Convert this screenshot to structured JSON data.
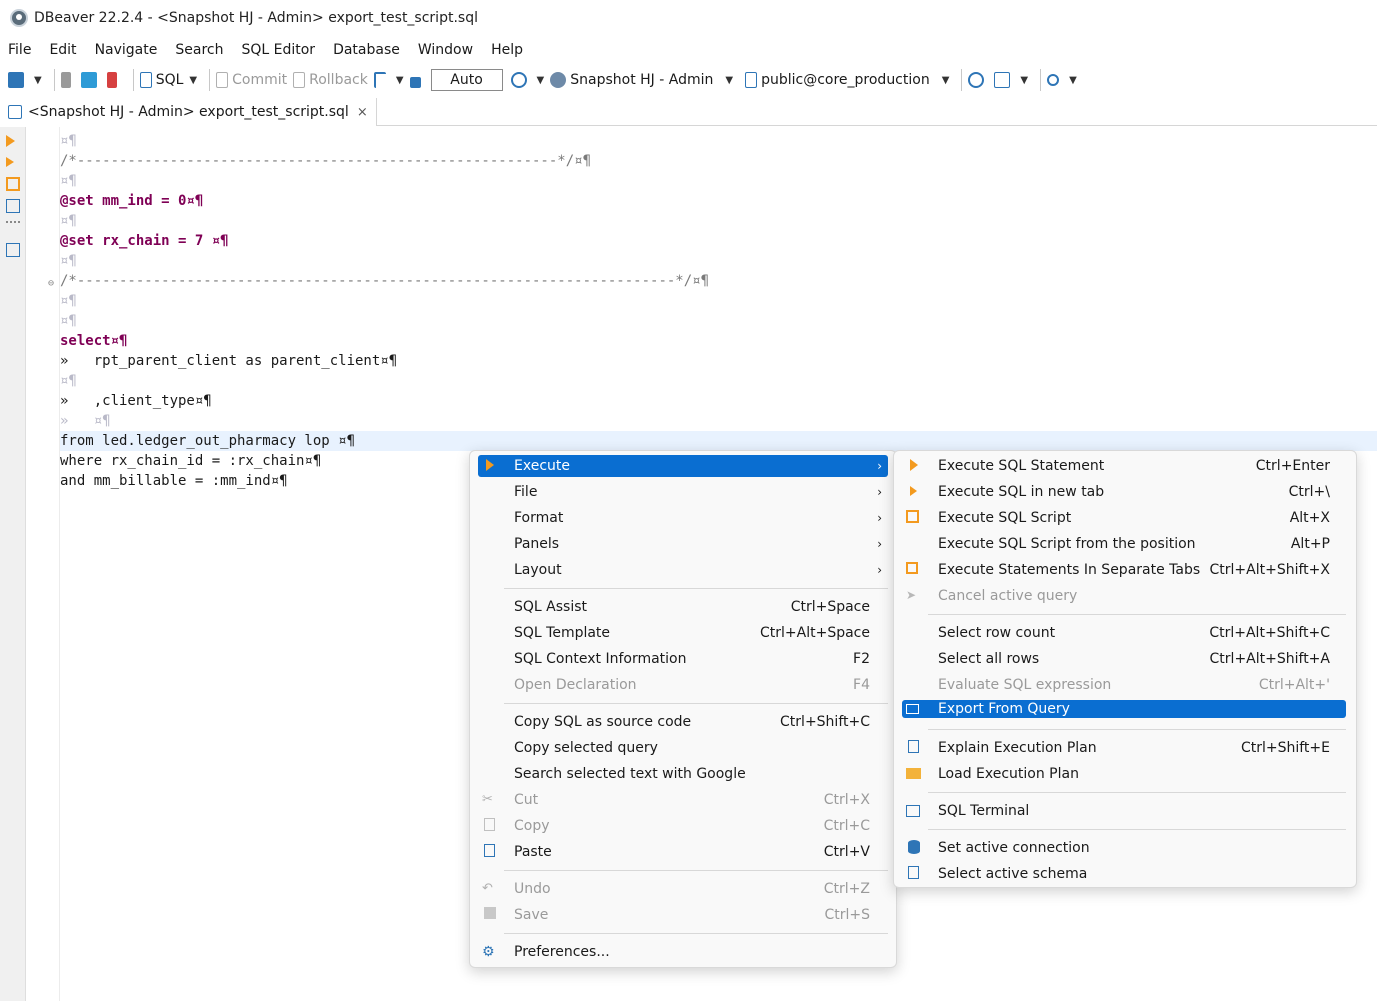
{
  "window": {
    "title": "DBeaver 22.2.4 - <Snapshot HJ - Admin> export_test_script.sql"
  },
  "menubar": [
    "File",
    "Edit",
    "Navigate",
    "Search",
    "SQL Editor",
    "Database",
    "Window",
    "Help"
  ],
  "toolbar": {
    "sql_label": "SQL",
    "commit_label": "Commit",
    "rollback_label": "Rollback",
    "auto_label": "Auto",
    "connection_label": "Snapshot HJ - Admin",
    "schema_label": "public@core_production"
  },
  "editor_tab": {
    "label": "<Snapshot HJ - Admin> export_test_script.sql",
    "close": "×"
  },
  "editor": {
    "lines": [
      "¤¶",
      "/*---------------------------------------------------------*/¤¶",
      "¤¶",
      "@set mm_ind = 0¤¶",
      "¤¶",
      "@set rx_chain = 7 ¤¶",
      "¤¶",
      "/*-----------------------------------------------------------------------*/¤¶",
      "¤¶",
      "¤¶",
      "select¤¶",
      "»   rpt_parent_client as parent_client¤¶",
      "¤¶",
      "»   ,client_type¤¶",
      "»   ¤¶",
      "from led.ledger_out_pharmacy lop ¤¶",
      "where rx_chain_id = :rx_chain¤¶",
      "and mm_billable = :mm_ind¤¶"
    ]
  },
  "context_menu": {
    "items": [
      {
        "label": "Execute",
        "accel": "",
        "submenu": true,
        "selected": true
      },
      {
        "label": "File",
        "accel": "",
        "submenu": true
      },
      {
        "label": "Format",
        "accel": "",
        "submenu": true
      },
      {
        "label": "Panels",
        "accel": "",
        "submenu": true
      },
      {
        "label": "Layout",
        "accel": "",
        "submenu": true
      },
      {
        "label": "SQL Assist",
        "accel": "Ctrl+Space"
      },
      {
        "label": "SQL Template",
        "accel": "Ctrl+Alt+Space"
      },
      {
        "label": "SQL Context Information",
        "accel": "F2"
      },
      {
        "label": "Open Declaration",
        "accel": "F4",
        "disabled": true
      },
      {
        "label": "Copy SQL as source code",
        "accel": "Ctrl+Shift+C"
      },
      {
        "label": "Copy selected query",
        "accel": ""
      },
      {
        "label": "Search selected text with Google",
        "accel": ""
      },
      {
        "label": "Cut",
        "accel": "Ctrl+X",
        "disabled": true
      },
      {
        "label": "Copy",
        "accel": "Ctrl+C",
        "disabled": true
      },
      {
        "label": "Paste",
        "accel": "Ctrl+V"
      },
      {
        "label": "Undo",
        "accel": "Ctrl+Z",
        "disabled": true
      },
      {
        "label": "Save",
        "accel": "Ctrl+S",
        "disabled": true
      },
      {
        "label": "Preferences...",
        "accel": ""
      }
    ]
  },
  "execute_submenu": {
    "items": [
      {
        "label": "Execute SQL Statement",
        "accel": "Ctrl+Enter"
      },
      {
        "label": "Execute SQL in new tab",
        "accel": "Ctrl+\\"
      },
      {
        "label": "Execute SQL Script",
        "accel": "Alt+X"
      },
      {
        "label": "Execute SQL Script from the position",
        "accel": "Alt+P"
      },
      {
        "label": "Execute Statements In Separate Tabs",
        "accel": "Ctrl+Alt+Shift+X"
      },
      {
        "label": "Cancel active query",
        "accel": "",
        "disabled": true
      },
      {
        "label": "Select row count",
        "accel": "Ctrl+Alt+Shift+C"
      },
      {
        "label": "Select all rows",
        "accel": "Ctrl+Alt+Shift+A"
      },
      {
        "label": "Evaluate SQL expression",
        "accel": "Ctrl+Alt+'",
        "disabled": true
      },
      {
        "label": "Export From Query",
        "accel": "",
        "selected": true
      },
      {
        "label": "Explain Execution Plan",
        "accel": "Ctrl+Shift+E"
      },
      {
        "label": "Load Execution Plan",
        "accel": ""
      },
      {
        "label": "SQL Terminal",
        "accel": ""
      },
      {
        "label": "Set active connection",
        "accel": ""
      },
      {
        "label": "Select active schema",
        "accel": ""
      }
    ]
  },
  "colors": {
    "selection": "#0a6ed1",
    "keyword": "#7f0055",
    "current_line": "#e8f2fe"
  }
}
